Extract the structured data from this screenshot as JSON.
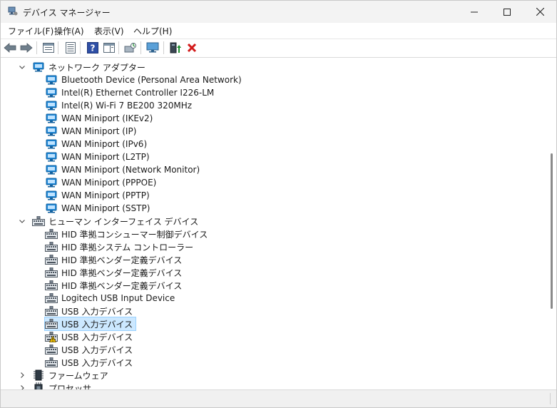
{
  "window": {
    "title": "デバイス マネージャー",
    "buttons": [
      "minimize",
      "maximize",
      "close"
    ]
  },
  "menu": [
    {
      "label": "ファイル(F)"
    },
    {
      "label": "操作(A)"
    },
    {
      "label": "表示(V)"
    },
    {
      "label": "ヘルプ(H)"
    }
  ],
  "toolbar": {
    "icons": [
      "back-arrow-icon",
      "forward-arrow-icon",
      "properties-view-icon",
      "device-list-icon",
      "help-icon",
      "action-pane-icon",
      "scan-hardware-icon",
      "monitor-icon",
      "update-driver-icon",
      "uninstall-x-icon"
    ],
    "accent_red": "#d21a1a",
    "accent_green": "#1f8f2f"
  },
  "tree": {
    "categories": [
      {
        "label": "ネットワーク アダプター",
        "expanded": true,
        "icon": "network-adapter-icon",
        "children": [
          {
            "label": "Bluetooth Device (Personal Area Network)"
          },
          {
            "label": "Intel(R) Ethernet Controller I226-LM"
          },
          {
            "label": "Intel(R) Wi-Fi 7 BE200 320MHz"
          },
          {
            "label": "WAN Miniport (IKEv2)"
          },
          {
            "label": "WAN Miniport (IP)"
          },
          {
            "label": "WAN Miniport (IPv6)"
          },
          {
            "label": "WAN Miniport (L2TP)"
          },
          {
            "label": "WAN Miniport (Network Monitor)"
          },
          {
            "label": "WAN Miniport (PPPOE)"
          },
          {
            "label": "WAN Miniport (PPTP)"
          },
          {
            "label": "WAN Miniport (SSTP)"
          }
        ]
      },
      {
        "label": "ヒューマン インターフェイス デバイス",
        "expanded": true,
        "icon": "hid-keyboard-icon",
        "children": [
          {
            "label": "HID 準拠コンシューマー制御デバイス"
          },
          {
            "label": "HID 準拠システム コントローラー"
          },
          {
            "label": "HID 準拠ベンダー定義デバイス"
          },
          {
            "label": "HID 準拠ベンダー定義デバイス"
          },
          {
            "label": "HID 準拠ベンダー定義デバイス"
          },
          {
            "label": "Logitech USB Input Device"
          },
          {
            "label": "USB 入力デバイス"
          },
          {
            "label": "USB 入力デバイス",
            "selected": true
          },
          {
            "label": "USB 入力デバイス",
            "warning": true
          },
          {
            "label": "USB 入力デバイス"
          },
          {
            "label": "USB 入力デバイス"
          }
        ]
      },
      {
        "label": "ファームウェア",
        "expanded": false,
        "icon": "firmware-chip-icon",
        "children": []
      },
      {
        "label": "プロセッサ",
        "expanded": false,
        "icon": "processor-icon",
        "children": []
      }
    ]
  },
  "colors": {
    "selection_bg": "#cce8ff",
    "selection_border": "#99d1ff",
    "network_icon": "#1e88d8",
    "warning_yellow": "#f2c200"
  }
}
